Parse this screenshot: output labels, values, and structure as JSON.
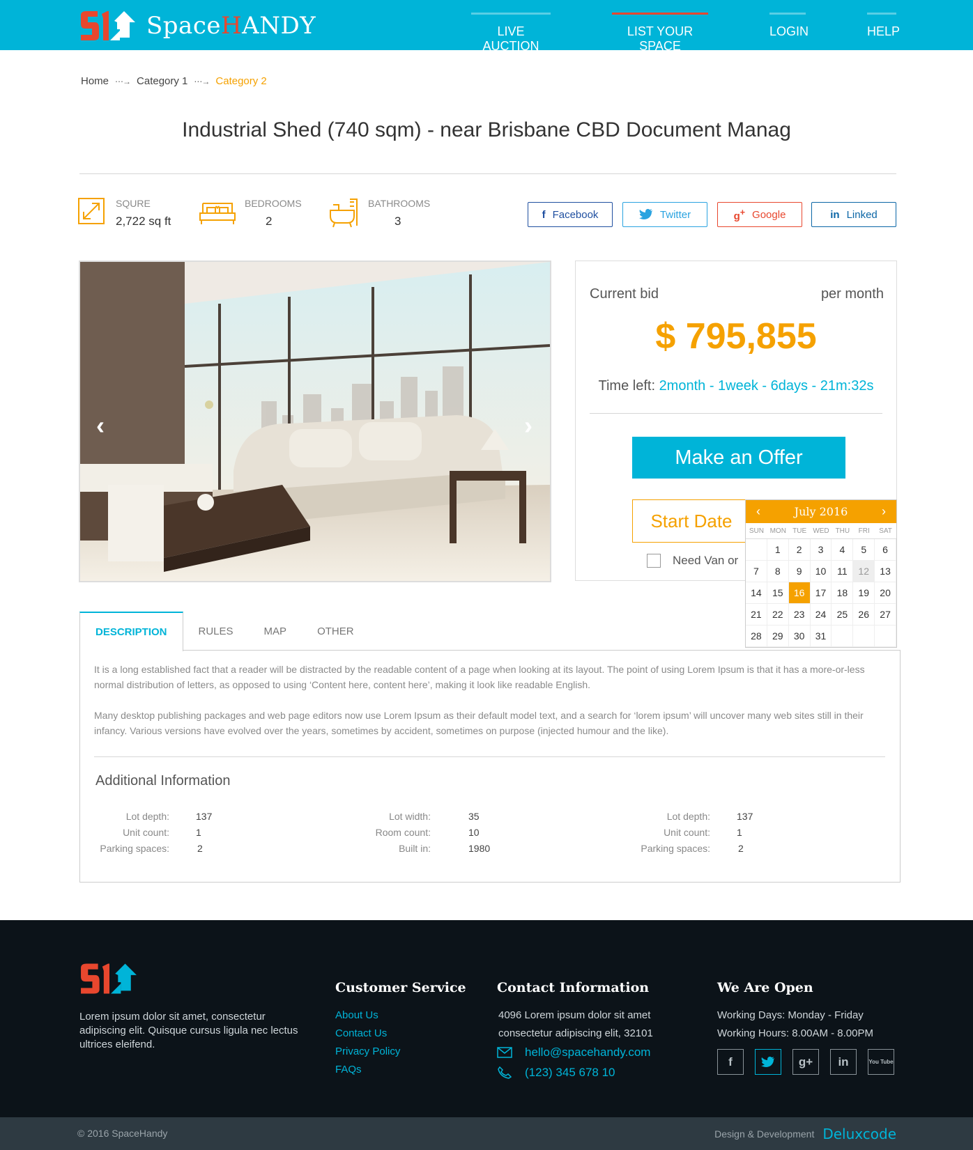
{
  "brand": {
    "name_part1": "Space",
    "name_part2": "H",
    "name_part3": "ANDY"
  },
  "nav": [
    {
      "label": "LIVE AUCTION"
    },
    {
      "label": "LIST YOUR SPACE"
    },
    {
      "label": "LOGIN"
    },
    {
      "label": "HELP"
    }
  ],
  "breadcrumb": {
    "home": "Home",
    "cat1": "Category 1",
    "cat2": "Category 2"
  },
  "title": "Industrial Shed (740 sqm) - near Brisbane CBD Document Manag",
  "features": {
    "squre": {
      "label": "SQURE",
      "value": "2,722 sq ft"
    },
    "bedrooms": {
      "label": "BEDROOMS",
      "value": "2"
    },
    "bathrooms": {
      "label": "BATHROOMS",
      "value": "3"
    }
  },
  "share": {
    "facebook": {
      "label": "Facebook",
      "icon": "f",
      "color": "#1f4fa0"
    },
    "twitter": {
      "label": "Twitter",
      "icon": "bird",
      "color": "#2aa3e0"
    },
    "google": {
      "label": "Google",
      "icon": "g+",
      "color": "#e8472e"
    },
    "linked": {
      "label": "Linked",
      "icon": "in",
      "color": "#0b66a6"
    }
  },
  "bid": {
    "current_label": "Current bid",
    "period": "per month",
    "price": "$ 795,855",
    "time_label": "Time left:",
    "time_value": "2month - 1week - 6days - 21m:32s",
    "offer_button": "Make an Offer",
    "start_date_button": "Start Date",
    "van_option": "Need Van or"
  },
  "calendar": {
    "month": "July 2016",
    "dows": [
      "SUN",
      "MON",
      "TUE",
      "WED",
      "THU",
      "FRI",
      "SAT"
    ],
    "days": [
      "",
      "1",
      "2",
      "3",
      "4",
      "5",
      "6",
      "7",
      "8",
      "9",
      "10",
      "11",
      "12",
      "13",
      "14",
      "15",
      "16",
      "17",
      "18",
      "19",
      "20",
      "21",
      "22",
      "23",
      "24",
      "25",
      "26",
      "27",
      "28",
      "29",
      "30",
      "31",
      "",
      "",
      ""
    ],
    "selected": "16",
    "today": "12"
  },
  "tabs": [
    {
      "label": "DESCRIPTION"
    },
    {
      "label": "RULES"
    },
    {
      "label": "MAP"
    },
    {
      "label": "OTHER"
    }
  ],
  "description": {
    "p1": "It is a long established fact that a reader will be distracted by the readable content of a page when looking at its layout. The point of using Lorem Ipsum is that it has a more-or-less normal distribution of letters, as opposed to using ‘Content here, content here’, making it look like readable English.",
    "p2": "Many desktop publishing packages and web page editors now use Lorem Ipsum as their default model text, and a search for ‘lorem ipsum’ will uncover many web sites still in their infancy. Various versions have evolved over the years, sometimes by accident, sometimes on purpose (injected humour and the like)."
  },
  "additional": {
    "title": "Additional Information",
    "col1": [
      {
        "k": "Lot depth:",
        "v": "137"
      },
      {
        "k": "Unit count:",
        "v": "1"
      },
      {
        "k": "Parking spaces:",
        "v": "2"
      }
    ],
    "col2": [
      {
        "k": "Lot width:",
        "v": "35"
      },
      {
        "k": "Room count:",
        "v": "10"
      },
      {
        "k": "Built in:",
        "v": "1980"
      }
    ],
    "col3": [
      {
        "k": "Lot depth:",
        "v": "137"
      },
      {
        "k": "Unit count:",
        "v": "1"
      },
      {
        "k": "Parking spaces:",
        "v": "2"
      }
    ]
  },
  "footer": {
    "about": "Lorem ipsum dolor sit amet, consectetur adipiscing elit. Quisque cursus ligula nec lectus ultrices eleifend.",
    "customer_service": {
      "title": "Customer Service",
      "links": [
        "About Us",
        "Contact Us",
        "Privacy Policy",
        "FAQs"
      ]
    },
    "contact": {
      "title": "Contact Information",
      "address1": "4096 Lorem ipsum dolor sit amet",
      "address2": "consectetur adipiscing elit, 32101",
      "email": "hello@spacehandy.com",
      "phone": "(123) 345 678 10"
    },
    "open": {
      "title": "We Are Open",
      "days": "Working Days: Monday - Friday",
      "hours": "Working Hours: 8.00AM - 8.00PM"
    },
    "social": [
      "f",
      "t",
      "g+",
      "in",
      "You Tube"
    ],
    "copyright": "© 2016 SpaceHandy",
    "design_label": "Design & Development",
    "design_brand": "Deluxcode"
  },
  "colors": {
    "accent": "#00b4d8",
    "orange": "#f5a100",
    "red": "#e8472e",
    "footer": "#0c1319"
  }
}
